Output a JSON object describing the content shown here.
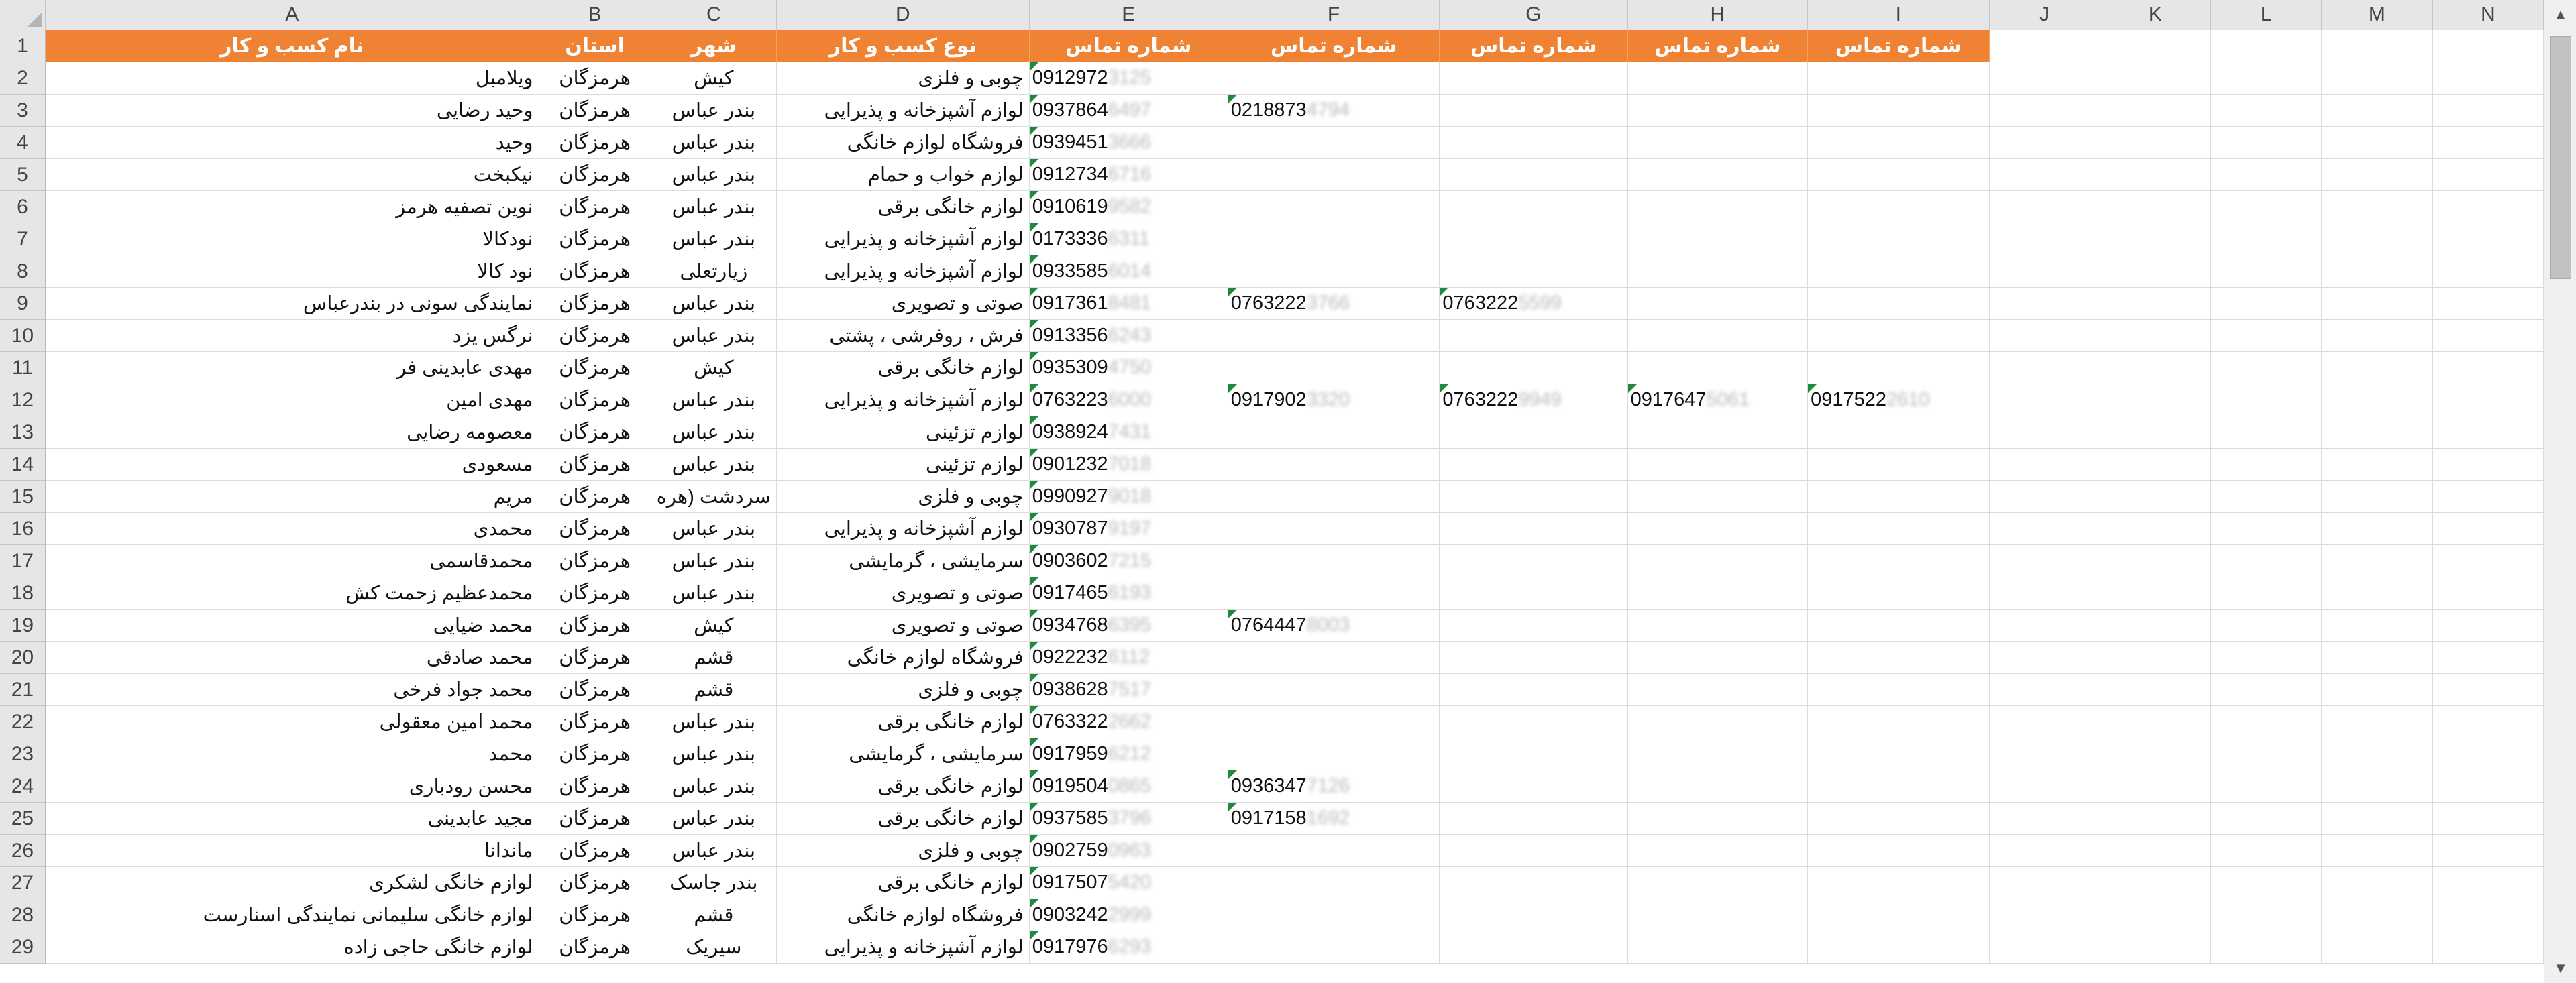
{
  "columns": [
    "A",
    "B",
    "C",
    "D",
    "E",
    "F",
    "G",
    "H",
    "I",
    "J",
    "K",
    "L",
    "M",
    "N"
  ],
  "header_row": {
    "num": "1",
    "cells": [
      "نام کسب و کار",
      "استان",
      "شهر",
      "نوع کسب و کار",
      "شماره تماس",
      "شماره تماس",
      "شماره تماس",
      "شماره تماس",
      "شماره تماس",
      "",
      "",
      "",
      "",
      ""
    ]
  },
  "rows": [
    {
      "num": "2",
      "name": "ویلامبل",
      "province": "هرمزگان",
      "city": "کیش",
      "type": "چوبی و فلزی",
      "phones": [
        [
          "0912972",
          "3125"
        ]
      ]
    },
    {
      "num": "3",
      "name": "وحید رضایی",
      "province": "هرمزگان",
      "city": "بندر عباس",
      "type": "لوازم آشپزخانه و پذیرایی",
      "phones": [
        [
          "0937864",
          "6497"
        ],
        [
          "0218873",
          "4794"
        ]
      ]
    },
    {
      "num": "4",
      "name": "وحید",
      "province": "هرمزگان",
      "city": "بندر عباس",
      "type": "فروشگاه لوازم خانگی",
      "phones": [
        [
          "0939451",
          "3666"
        ]
      ]
    },
    {
      "num": "5",
      "name": "نیکبخت",
      "province": "هرمزگان",
      "city": "بندر عباس",
      "type": "لوازم خواب و حمام",
      "phones": [
        [
          "0912734",
          "6716"
        ]
      ]
    },
    {
      "num": "6",
      "name": "نوین تصفیه هرمز",
      "province": "هرمزگان",
      "city": "بندر عباس",
      "type": "لوازم خانگی برقی",
      "phones": [
        [
          "0910619",
          "9582"
        ]
      ]
    },
    {
      "num": "7",
      "name": "نودکالا",
      "province": "هرمزگان",
      "city": "بندر عباس",
      "type": "لوازم آشپزخانه و پذیرایی",
      "phones": [
        [
          "0173336",
          "6311"
        ]
      ]
    },
    {
      "num": "8",
      "name": "نود کالا",
      "province": "هرمزگان",
      "city": "زیارتعلی",
      "type": "لوازم آشپزخانه و پذیرایی",
      "phones": [
        [
          "0933585",
          "6014"
        ]
      ]
    },
    {
      "num": "9",
      "name": "نمایندگی سونی در بندرعباس",
      "province": "هرمزگان",
      "city": "بندر عباس",
      "type": "صوتی و تصویری",
      "phones": [
        [
          "0917361",
          "8481"
        ],
        [
          "0763222",
          "3766"
        ],
        [
          "0763222",
          "5599"
        ]
      ]
    },
    {
      "num": "10",
      "name": "نرگس یزد",
      "province": "هرمزگان",
      "city": "بندر عباس",
      "type": "فرش ، روفرشی ، پشتی",
      "phones": [
        [
          "0913356",
          "6243"
        ]
      ]
    },
    {
      "num": "11",
      "name": "مهدی عابدینی فر",
      "province": "هرمزگان",
      "city": "کیش",
      "type": "لوازم خانگی برقی",
      "phones": [
        [
          "0935309",
          "4750"
        ]
      ]
    },
    {
      "num": "12",
      "name": "مهدی امین",
      "province": "هرمزگان",
      "city": "بندر عباس",
      "type": "لوازم آشپزخانه و پذیرایی",
      "phones": [
        [
          "0763223",
          "6000"
        ],
        [
          "0917902",
          "3320"
        ],
        [
          "0763222",
          "9949"
        ],
        [
          "0917647",
          "5061"
        ],
        [
          "0917522",
          "2610"
        ]
      ]
    },
    {
      "num": "13",
      "name": "معصومه رضایی",
      "province": "هرمزگان",
      "city": "بندر عباس",
      "type": "لوازم تزئینی",
      "phones": [
        [
          "0938924",
          "7431"
        ]
      ]
    },
    {
      "num": "14",
      "name": "مسعودی",
      "province": "هرمزگان",
      "city": "بندر عباس",
      "type": "لوازم تزئینی",
      "phones": [
        [
          "0901232",
          "7018"
        ]
      ]
    },
    {
      "num": "15",
      "name": "مریم",
      "province": "هرمزگان",
      "city": "سردشت (هره",
      "type": "چوبی و فلزی",
      "phones": [
        [
          "0990927",
          "9018"
        ]
      ]
    },
    {
      "num": "16",
      "name": "محمدی",
      "province": "هرمزگان",
      "city": "بندر عباس",
      "type": "لوازم آشپزخانه و پذیرایی",
      "phones": [
        [
          "0930787",
          "9197"
        ]
      ]
    },
    {
      "num": "17",
      "name": "محمدقاسمی",
      "province": "هرمزگان",
      "city": "بندر عباس",
      "type": "سرمایشی ، گرمایشی",
      "phones": [
        [
          "0903602",
          "7215"
        ]
      ]
    },
    {
      "num": "18",
      "name": "محمدعظیم زحمت کش",
      "province": "هرمزگان",
      "city": "بندر عباس",
      "type": "صوتی و تصویری",
      "phones": [
        [
          "0917465",
          "6193"
        ]
      ]
    },
    {
      "num": "19",
      "name": "محمد ضیایی",
      "province": "هرمزگان",
      "city": "کیش",
      "type": "صوتی و تصویری",
      "phones": [
        [
          "0934768",
          "6395"
        ],
        [
          "0764447",
          "8003"
        ]
      ]
    },
    {
      "num": "20",
      "name": "محمد صادقی",
      "province": "هرمزگان",
      "city": "قشم",
      "type": "فروشگاه لوازم خانگی",
      "phones": [
        [
          "0922232",
          "6112"
        ]
      ]
    },
    {
      "num": "21",
      "name": "محمد جواد فرخی",
      "province": "هرمزگان",
      "city": "قشم",
      "type": "چوبی و فلزی",
      "phones": [
        [
          "0938628",
          "7517"
        ]
      ]
    },
    {
      "num": "22",
      "name": "محمد امین معقولی",
      "province": "هرمزگان",
      "city": "بندر عباس",
      "type": "لوازم خانگی برقی",
      "phones": [
        [
          "0763322",
          "2662"
        ]
      ]
    },
    {
      "num": "23",
      "name": "محمد",
      "province": "هرمزگان",
      "city": "بندر عباس",
      "type": "سرمایشی ، گرمایشی",
      "phones": [
        [
          "0917959",
          "6212"
        ]
      ]
    },
    {
      "num": "24",
      "name": "محسن رودباری",
      "province": "هرمزگان",
      "city": "بندر عباس",
      "type": "لوازم خانگی برقی",
      "phones": [
        [
          "0919504",
          "0865"
        ],
        [
          "0936347",
          "7126"
        ]
      ]
    },
    {
      "num": "25",
      "name": "مجید عابدینی",
      "province": "هرمزگان",
      "city": "بندر عباس",
      "type": "لوازم خانگی برقی",
      "phones": [
        [
          "0937585",
          "3796"
        ],
        [
          "0917158",
          "1692"
        ]
      ]
    },
    {
      "num": "26",
      "name": "ماندانا",
      "province": "هرمزگان",
      "city": "بندر عباس",
      "type": "چوبی و فلزی",
      "phones": [
        [
          "0902759",
          "0963"
        ]
      ]
    },
    {
      "num": "27",
      "name": "لوازم خانگی لشکری",
      "province": "هرمزگان",
      "city": "بندر جاسک",
      "type": "لوازم خانگی برقی",
      "phones": [
        [
          "0917507",
          "5420"
        ]
      ]
    },
    {
      "num": "28",
      "name": "لوازم خانگی سلیمانی نمایندگی اسنارست",
      "province": "هرمزگان",
      "city": "قشم",
      "type": "فروشگاه لوازم خانگی",
      "phones": [
        [
          "0903242",
          "2999"
        ]
      ]
    },
    {
      "num": "29",
      "name": "لوازم خانگی حاجی زاده",
      "province": "هرمزگان",
      "city": "سیریک",
      "type": "لوازم آشپزخانه و پذیرایی",
      "phones": [
        [
          "0917976",
          "6293"
        ]
      ]
    }
  ],
  "colors": {
    "header_fill": "#ef8233",
    "header_text": "#ffffff",
    "comment_marker": "#1e8a3c",
    "grid": "#dcdcdc"
  }
}
